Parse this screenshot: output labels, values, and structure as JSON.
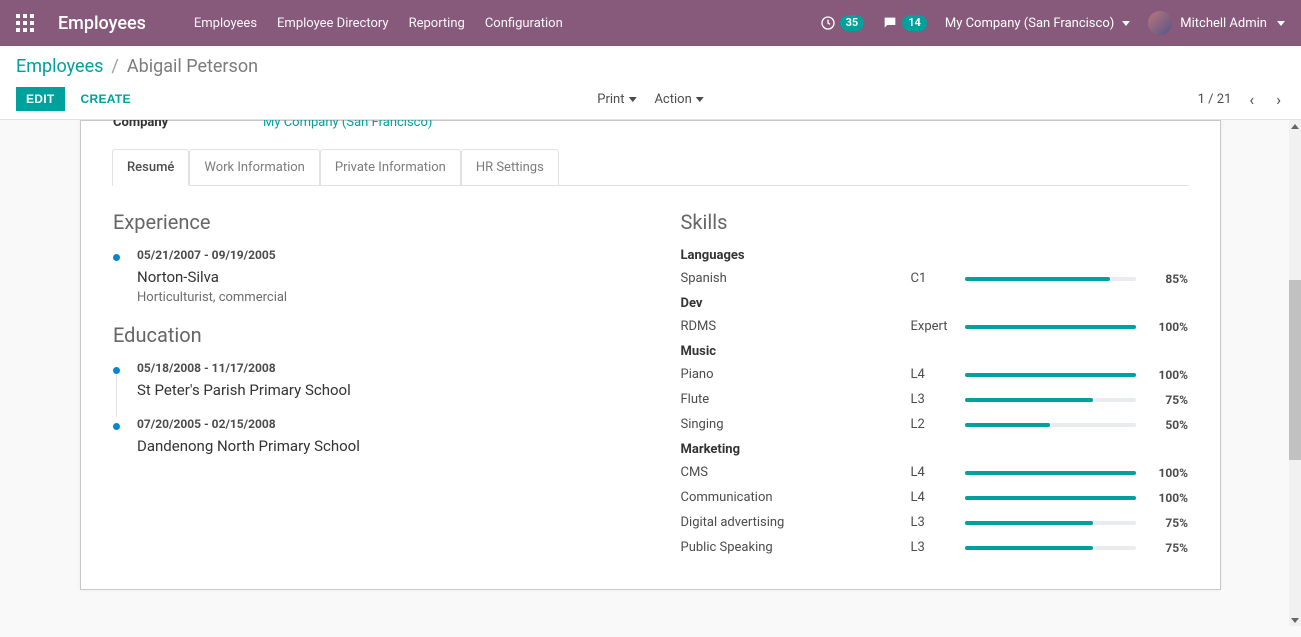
{
  "navbar": {
    "brand": "Employees",
    "menu": [
      "Employees",
      "Employee Directory",
      "Reporting",
      "Configuration"
    ],
    "activity_count": "35",
    "message_count": "14",
    "company": "My Company (San Francisco)",
    "user": "Mitchell Admin"
  },
  "breadcrumb": {
    "root": "Employees",
    "current": "Abigail Peterson"
  },
  "toolbar": {
    "edit": "EDIT",
    "create": "CREATE",
    "print": "Print",
    "action": "Action",
    "pager": "1 / 21"
  },
  "form": {
    "company_label": "Company",
    "company_value": "My Company (San Francisco)"
  },
  "tabs": [
    "Resumé",
    "Work Information",
    "Private Information",
    "HR Settings"
  ],
  "resume": {
    "experience_heading": "Experience",
    "experience": [
      {
        "dates": "05/21/2007 - 09/19/2005",
        "title": "Norton-Silva",
        "subtitle": "Horticulturist, commercial"
      }
    ],
    "education_heading": "Education",
    "education": [
      {
        "dates": "05/18/2008 - 11/17/2008",
        "title": "St Peter's Parish Primary School"
      },
      {
        "dates": "07/20/2005 - 02/15/2008",
        "title": "Dandenong North Primary School"
      }
    ],
    "skills_heading": "Skills",
    "skill_groups": [
      {
        "name": "Languages",
        "skills": [
          {
            "name": "Spanish",
            "level": "C1",
            "pct": 85
          }
        ]
      },
      {
        "name": "Dev",
        "skills": [
          {
            "name": "RDMS",
            "level": "Expert",
            "pct": 100
          }
        ]
      },
      {
        "name": "Music",
        "skills": [
          {
            "name": "Piano",
            "level": "L4",
            "pct": 100
          },
          {
            "name": "Flute",
            "level": "L3",
            "pct": 75
          },
          {
            "name": "Singing",
            "level": "L2",
            "pct": 50
          }
        ]
      },
      {
        "name": "Marketing",
        "skills": [
          {
            "name": "CMS",
            "level": "L4",
            "pct": 100
          },
          {
            "name": "Communication",
            "level": "L4",
            "pct": 100
          },
          {
            "name": "Digital advertising",
            "level": "L3",
            "pct": 75
          },
          {
            "name": "Public Speaking",
            "level": "L3",
            "pct": 75
          }
        ]
      }
    ]
  }
}
